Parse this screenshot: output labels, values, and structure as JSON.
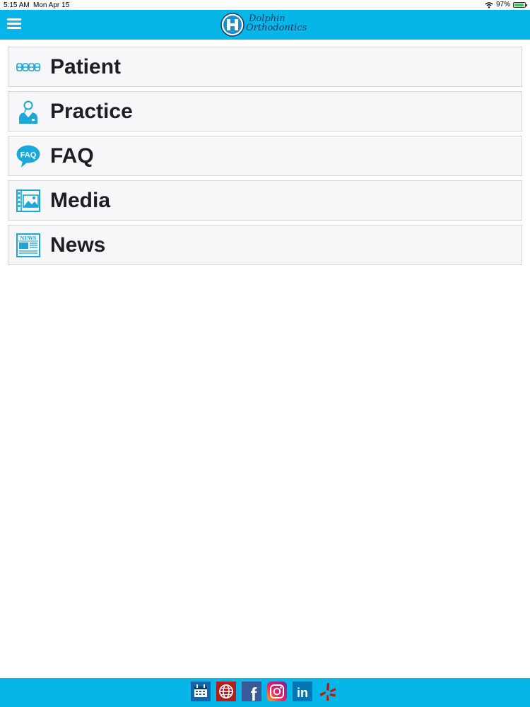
{
  "status_bar": {
    "time": "5:15 AM",
    "date": "Mon Apr 15",
    "battery": "97%"
  },
  "header": {
    "logo_line1": "Dolphin",
    "logo_line2": "Orthodontics"
  },
  "menu": {
    "items": [
      {
        "label": "Patient",
        "icon": "braces-icon"
      },
      {
        "label": "Practice",
        "icon": "doctor-icon"
      },
      {
        "label": "FAQ",
        "icon": "faq-icon",
        "icon_text": "FAQ"
      },
      {
        "label": "Media",
        "icon": "media-icon"
      },
      {
        "label": "News",
        "icon": "newspaper-icon",
        "icon_text": "NEWS"
      }
    ]
  },
  "footer": {
    "links": [
      "calendar-icon",
      "website-icon",
      "facebook-icon",
      "instagram-icon",
      "linkedin-icon",
      "yelp-icon"
    ],
    "facebook_glyph": "f",
    "linkedin_glyph": "in"
  },
  "colors": {
    "accent": "#06b6e8",
    "icon_blue": "#1aa7d9",
    "logo_navy": "#0d3b66"
  }
}
